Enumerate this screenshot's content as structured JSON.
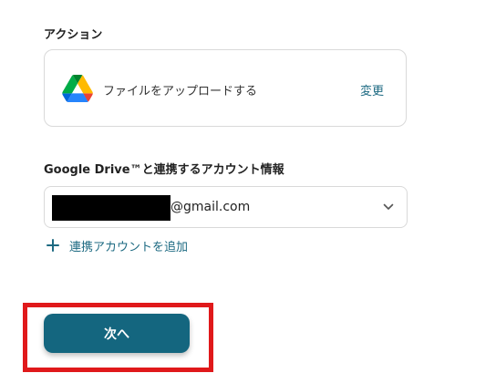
{
  "action": {
    "section_label": "アクション",
    "app_icon": "google-drive-icon",
    "action_name": "ファイルをアップロードする",
    "change_label": "変更"
  },
  "account": {
    "section_label": "Google Drive™と連携するアカウント情報",
    "selected_email_suffix": "@gmail.com",
    "dropdown_icon": "chevron-down-icon",
    "add_account_label": "連携アカウントを追加"
  },
  "footer": {
    "next_button_label": "次へ"
  },
  "colors": {
    "accent": "#14667f",
    "link": "#1d6a82",
    "highlight": "#e0191b",
    "border": "#d9d9d9"
  }
}
